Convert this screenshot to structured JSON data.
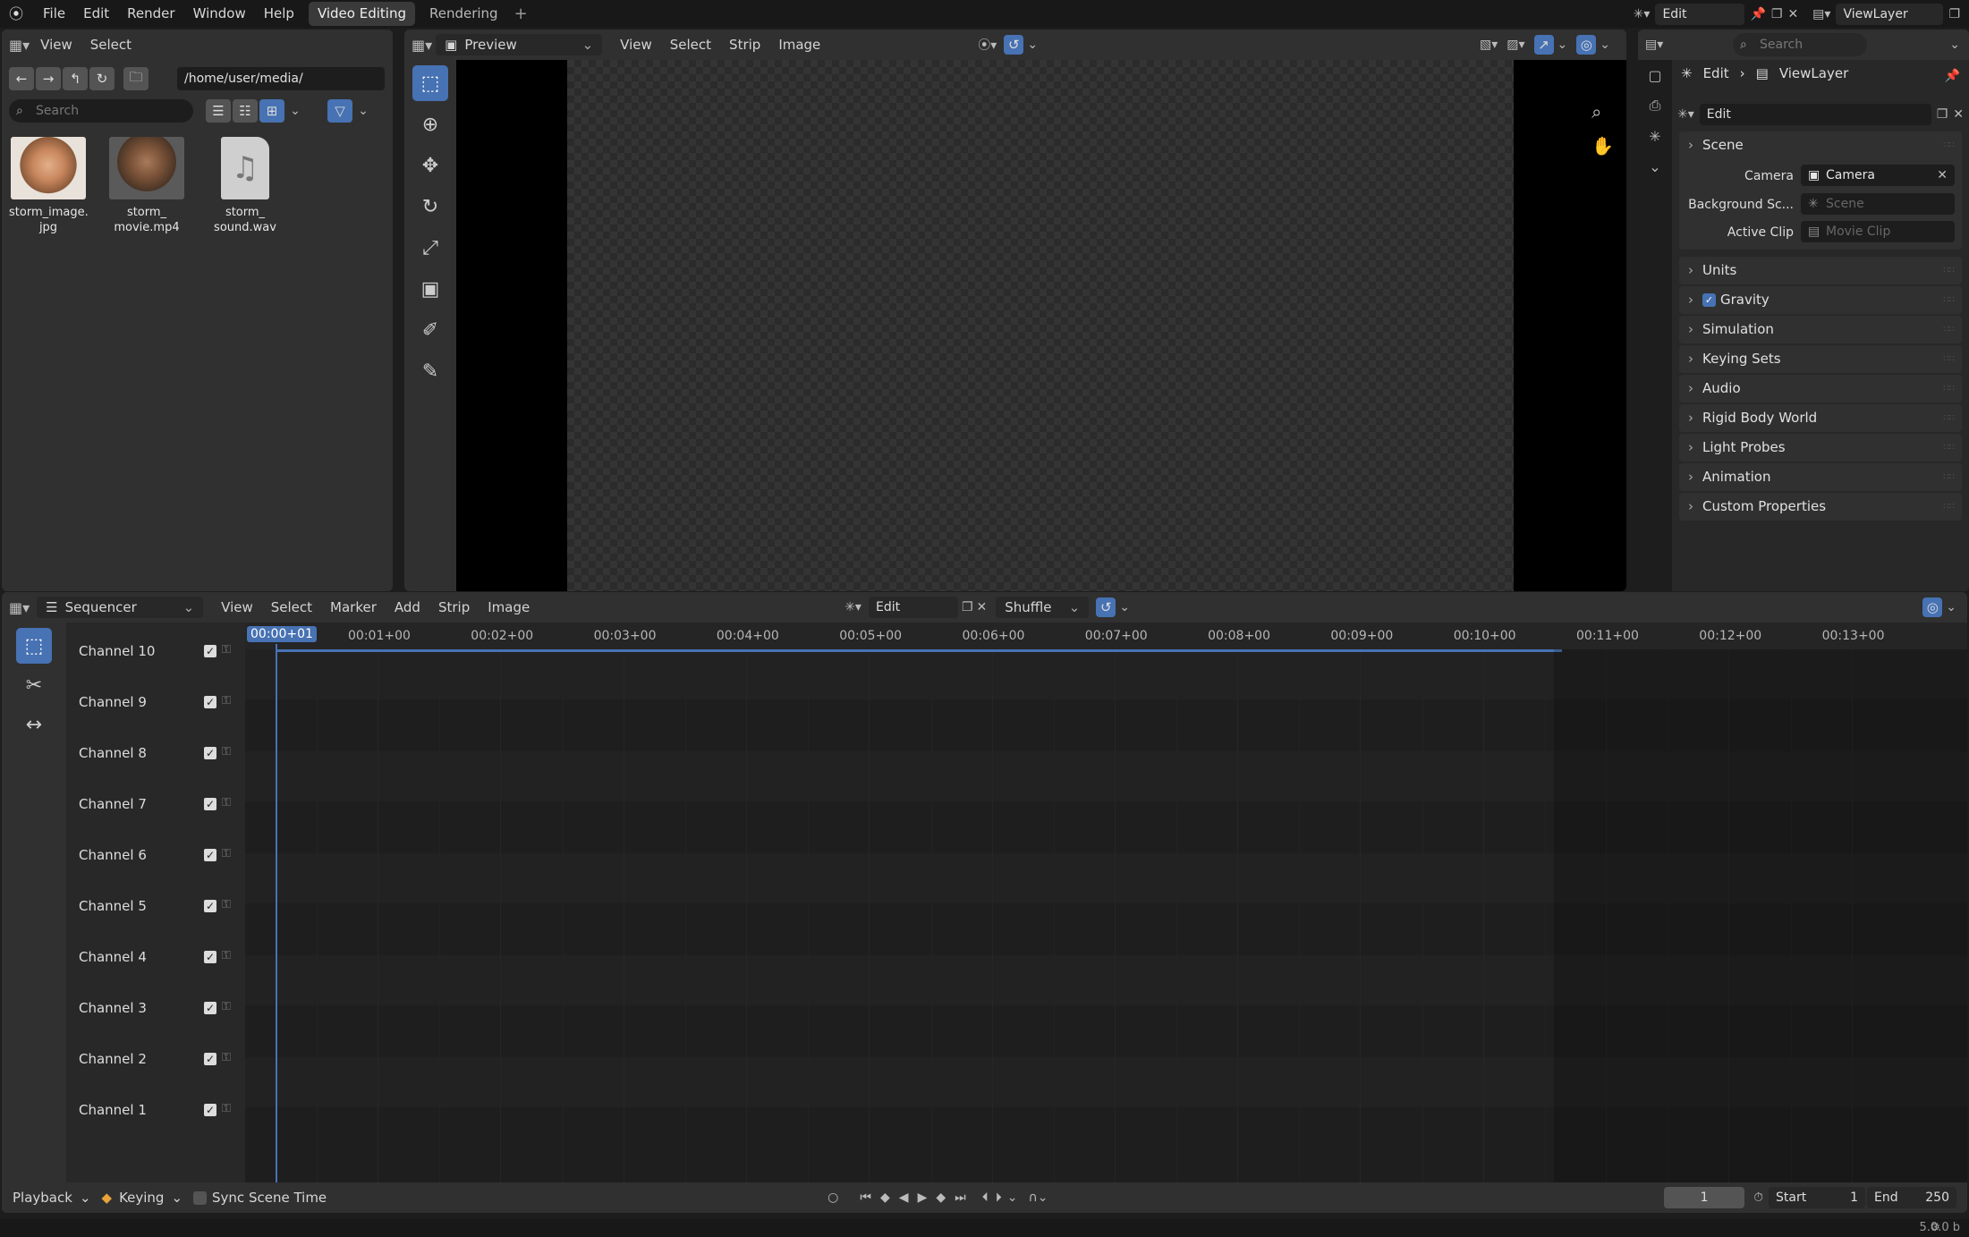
{
  "topbar": {
    "menus": [
      "File",
      "Edit",
      "Render",
      "Window",
      "Help"
    ],
    "workspaces": [
      {
        "label": "Video Editing",
        "active": true
      },
      {
        "label": "Rendering",
        "active": false
      }
    ],
    "scene": "Edit",
    "view_layer": "ViewLayer"
  },
  "file_browser": {
    "menus": [
      "View",
      "Select"
    ],
    "path": "/home/user/media/",
    "search_placeholder": "Search",
    "files": [
      {
        "name_line1": "storm_image.",
        "name_line2": "jpg",
        "kind": "image"
      },
      {
        "name_line1": "storm_",
        "name_line2": "movie.mp4",
        "kind": "movie"
      },
      {
        "name_line1": "storm_",
        "name_line2": "sound.wav",
        "kind": "sound"
      }
    ]
  },
  "preview": {
    "mode": "Preview",
    "menus": [
      "View",
      "Select",
      "Strip",
      "Image"
    ]
  },
  "properties": {
    "search_placeholder": "Search",
    "breadcrumb": [
      "Edit",
      "ViewLayer"
    ],
    "scene_field": "Edit",
    "scene_panel": "Scene",
    "rows": [
      {
        "label": "Camera",
        "value": "Camera",
        "dim": false
      },
      {
        "label": "Background Sc...",
        "value": "Scene",
        "dim": true
      },
      {
        "label": "Active Clip",
        "value": "Movie Clip",
        "dim": true
      }
    ],
    "sections": [
      "Units",
      "Gravity",
      "Simulation",
      "Keying Sets",
      "Audio",
      "Rigid Body World",
      "Light Probes",
      "Animation",
      "Custom Properties"
    ],
    "gravity_checked": true
  },
  "sequencer": {
    "mode": "Sequencer",
    "menus": [
      "View",
      "Select",
      "Marker",
      "Add",
      "Strip",
      "Image"
    ],
    "scene": "Edit",
    "overlap_mode": "Shuffle",
    "current_time": "00:00+01",
    "ruler": [
      "00:01+00",
      "00:02+00",
      "00:03+00",
      "00:04+00",
      "00:05+00",
      "00:06+00",
      "00:07+00",
      "00:08+00",
      "00:09+00",
      "00:10+00",
      "00:11+00",
      "00:12+00",
      "00:13+00"
    ],
    "channels": [
      "Channel 10",
      "Channel 9",
      "Channel 8",
      "Channel 7",
      "Channel 6",
      "Channel 5",
      "Channel 4",
      "Channel 3",
      "Channel 2",
      "Channel 1"
    ]
  },
  "playback": {
    "playback_label": "Playback",
    "keying_label": "Keying",
    "sync_label": "Sync Scene Time",
    "current_frame": "1",
    "start_label": "Start",
    "start_value": "1",
    "end_label": "End",
    "end_value": "250"
  },
  "status": {
    "version": "5.0.0 b"
  },
  "colors": {
    "accent": "#4772b3",
    "background": "#1d1d1d",
    "panel": "#303030"
  }
}
